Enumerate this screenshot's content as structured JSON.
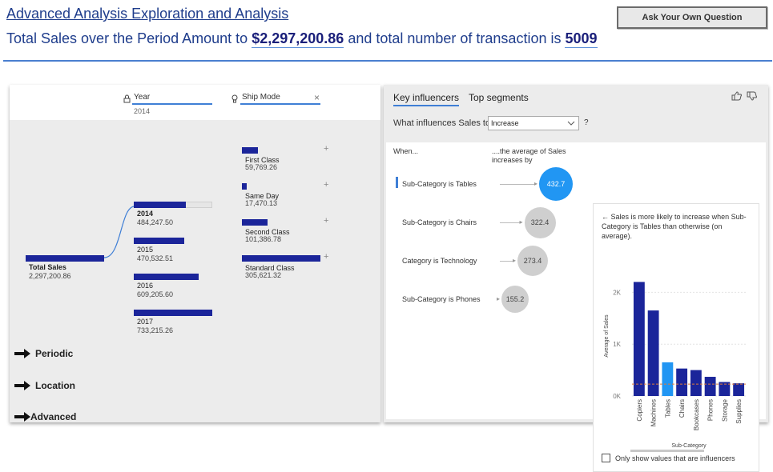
{
  "header": {
    "title": "Advanced Analysis Exploration and Analysis ",
    "summary_prefix": "Total Sales over the Period Amount to ",
    "total_sales": "$2,297,200.86",
    "summary_middle": " and total number of transaction is ",
    "transaction_count": "5009",
    "ask_button": "Ask Your Own Question"
  },
  "decomposition_tree": {
    "levels": [
      {
        "title": "Year",
        "subtitle": "2014",
        "icon": "lock-icon"
      },
      {
        "title": "Ship Mode",
        "icon": "lightbulb-icon",
        "close": "×"
      }
    ],
    "root": {
      "label": "Total Sales",
      "value": "2,297,200.86"
    },
    "years": [
      {
        "label": "2014",
        "value": "484,247.50",
        "share": 0.66
      },
      {
        "label": "2015",
        "value": "470,532.51",
        "share": 0.64
      },
      {
        "label": "2016",
        "value": "609,205.60",
        "share": 0.83
      },
      {
        "label": "2017",
        "value": "733,215.26",
        "share": 1.0
      }
    ],
    "ship_modes": [
      {
        "label": "First Class",
        "value": "59,769.26",
        "share": 0.2
      },
      {
        "label": "Same Day",
        "value": "17,470.13",
        "share": 0.06
      },
      {
        "label": "Second Class",
        "value": "101,386.78",
        "share": 0.33
      },
      {
        "label": "Standard Class",
        "value": "305,621.32",
        "share": 1.0
      }
    ],
    "plus_glyph": "+",
    "nav": [
      {
        "label": "Periodic",
        "icon": "arrow-right-icon"
      },
      {
        "label": "Location",
        "icon": "arrow-right-icon"
      },
      {
        "label": "Advanced",
        "icon": "arrow-right-icon"
      }
    ]
  },
  "key_influencers": {
    "tabs": [
      "Key influencers",
      "Top segments"
    ],
    "active_tab": "Key influencers",
    "question": "What influences Sales to",
    "question_value": "Increase",
    "help": "?",
    "column_when": "When...",
    "column_avg": "....the average of Sales increases by",
    "influencers": [
      {
        "label": "Sub-Category is Tables",
        "value": "432.7",
        "selected": true
      },
      {
        "label": "Sub-Category is Chairs",
        "value": "322.4",
        "selected": false
      },
      {
        "label": "Category is Technology",
        "value": "273.4",
        "selected": false
      },
      {
        "label": "Sub-Category is Phones",
        "value": "155.2",
        "selected": false
      }
    ],
    "detail_text": "Sales is more likely to increase when Sub-Category is Tables than otherwise (on average).",
    "back_arrow": "←",
    "checkbox_label": "Only show values that are influencers",
    "colors": {
      "selected_bubble": "#2196f3",
      "bubble": "#cfcfcf",
      "bar": "#1b259a",
      "highlight_bar": "#2196f3",
      "average_line": "#e07b39"
    }
  },
  "chart_data": {
    "type": "bar",
    "title": "",
    "xlabel": "Sub-Category",
    "ylabel": "Average of Sales",
    "categories": [
      "Copiers",
      "Machines",
      "Tables",
      "Chairs",
      "Bookcases",
      "Phones",
      "Storage",
      "Supplies"
    ],
    "values": [
      2200,
      1650,
      650,
      530,
      500,
      370,
      270,
      245
    ],
    "highlight": "Tables",
    "average_line": 230,
    "ylim": [
      0,
      2500
    ],
    "yticks": [
      {
        "value": 0,
        "label": "0K"
      },
      {
        "value": 1000,
        "label": "1K"
      },
      {
        "value": 2000,
        "label": "2K"
      }
    ],
    "grid": true
  }
}
